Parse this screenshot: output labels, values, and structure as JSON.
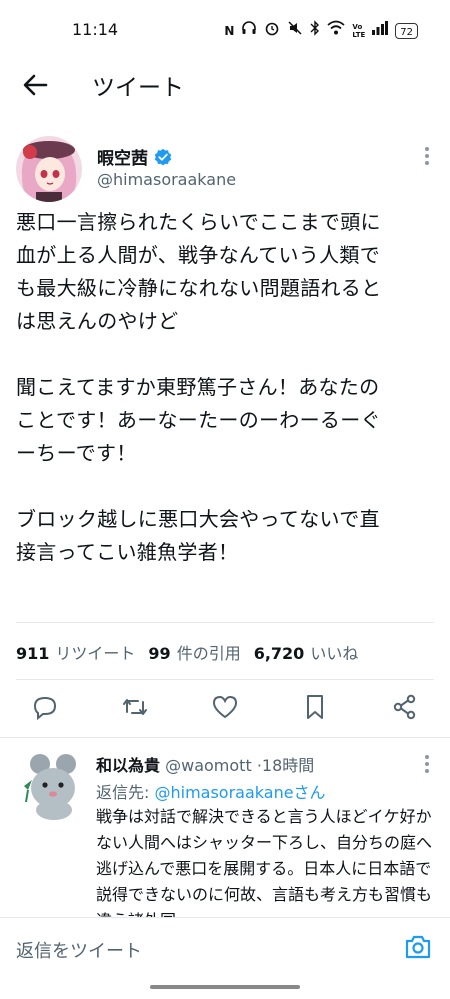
{
  "status_bar": {
    "time": "11:14",
    "nfc": "N",
    "network_label": "Vo\nLTE",
    "battery": "72"
  },
  "header": {
    "title": "ツイート"
  },
  "tweet": {
    "author_name": "暇空茜",
    "author_handle": "@himasoraakane",
    "paragraphs": [
      "悪口一言擦られたくらいでここまで頭に\n血が上る人間が、戦争なんていう人類で\nも最大級に冷静になれない問題語れると\nは思えんのやけど",
      "聞こえてますか東野篤子さん！あなたの\nことです！あーなーたーのーわーるーぐ\nーちーです！",
      "ブロック越しに悪口大会やってないで直\n接言ってこい雑魚学者！"
    ],
    "stats": [
      {
        "num": "911",
        "label": "リツイート"
      },
      {
        "num": "99",
        "label": "件の引用"
      },
      {
        "num": "6,720",
        "label": "いいね"
      }
    ]
  },
  "reply": {
    "name": "和以為貴",
    "handle": "@waomott",
    "time": "18時間",
    "reply_to_prefix": "返信先: ",
    "reply_to_handle": "@himasoraakaneさん",
    "text": "戦争は対話で解決できると言う人ほどイケ好かない人間へはシャッター下ろし、自分ちの庭へ逃げ込んで悪口を展開する。日本人に日本語で説得できないのに何故、言語も考え方も習慣も違う諸外国"
  },
  "compose": {
    "placeholder": "返信をツイート"
  },
  "colors": {
    "accent": "#1d9bf0",
    "text": "#0f1419",
    "secondary": "#536471"
  }
}
